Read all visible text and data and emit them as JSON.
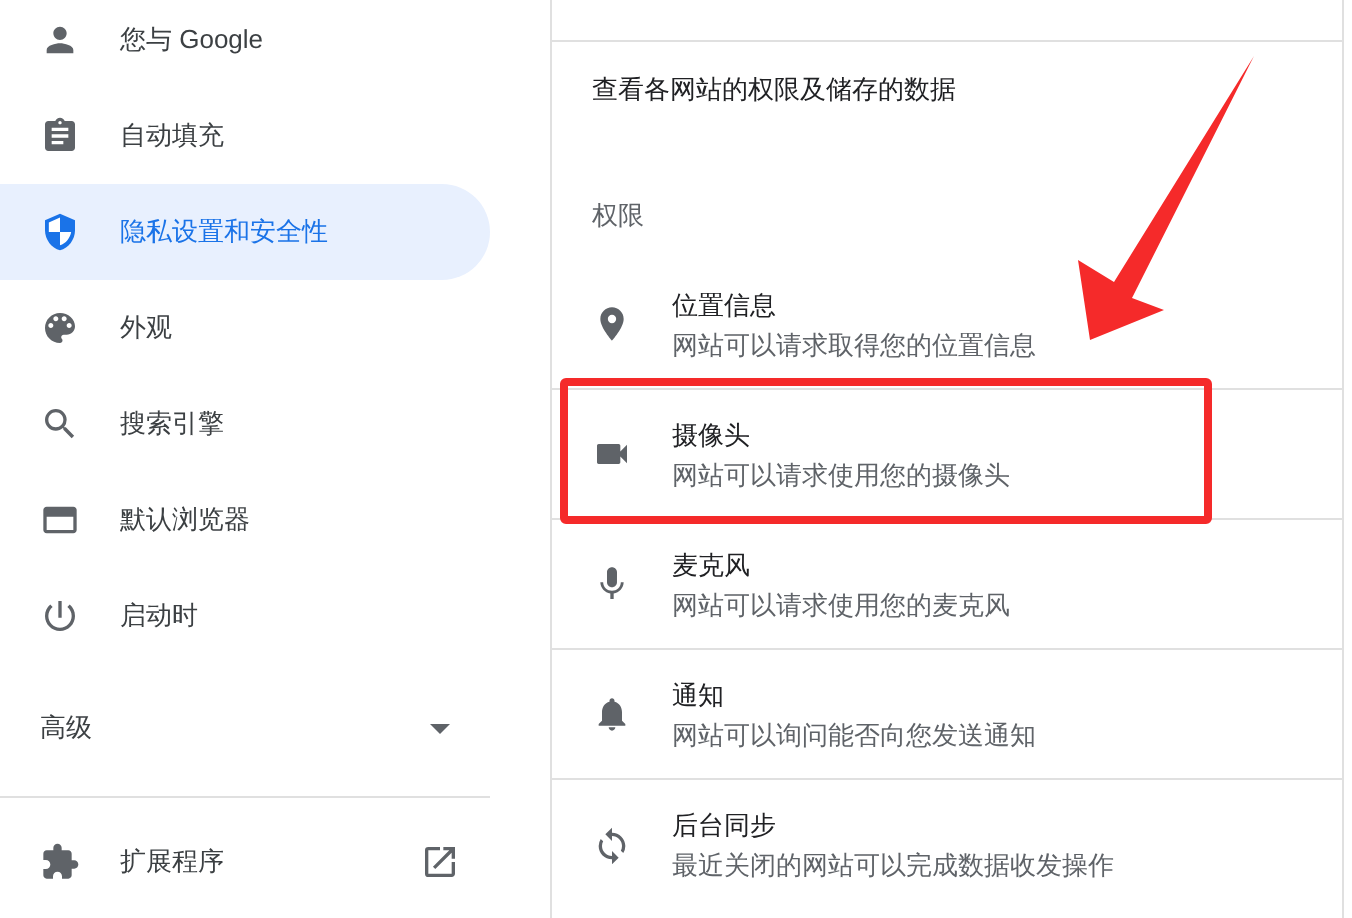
{
  "sidebar": {
    "items": [
      {
        "label": "您与 Google",
        "selected": false
      },
      {
        "label": "自动填充",
        "selected": false
      },
      {
        "label": "隐私设置和安全性",
        "selected": true
      },
      {
        "label": "外观",
        "selected": false
      },
      {
        "label": "搜索引擎",
        "selected": false
      },
      {
        "label": "默认浏览器",
        "selected": false
      },
      {
        "label": "启动时",
        "selected": false
      }
    ],
    "advanced": {
      "label": "高级",
      "expanded": false
    },
    "extensions": {
      "label": "扩展程序"
    }
  },
  "content": {
    "site_settings_link": "查看各网站的权限及储存的数据",
    "section_title": "权限",
    "permissions": [
      {
        "title": "位置信息",
        "description": "网站可以请求取得您的位置信息",
        "highlighted": false
      },
      {
        "title": "摄像头",
        "description": "网站可以请求使用您的摄像头",
        "highlighted": true
      },
      {
        "title": "麦克风",
        "description": "网站可以请求使用您的麦克风",
        "highlighted": false
      },
      {
        "title": "通知",
        "description": "网站可以询问能否向您发送通知",
        "highlighted": false
      },
      {
        "title": "后台同步",
        "description": "最近关闭的网站可以完成数据收发操作",
        "highlighted": false
      }
    ]
  }
}
